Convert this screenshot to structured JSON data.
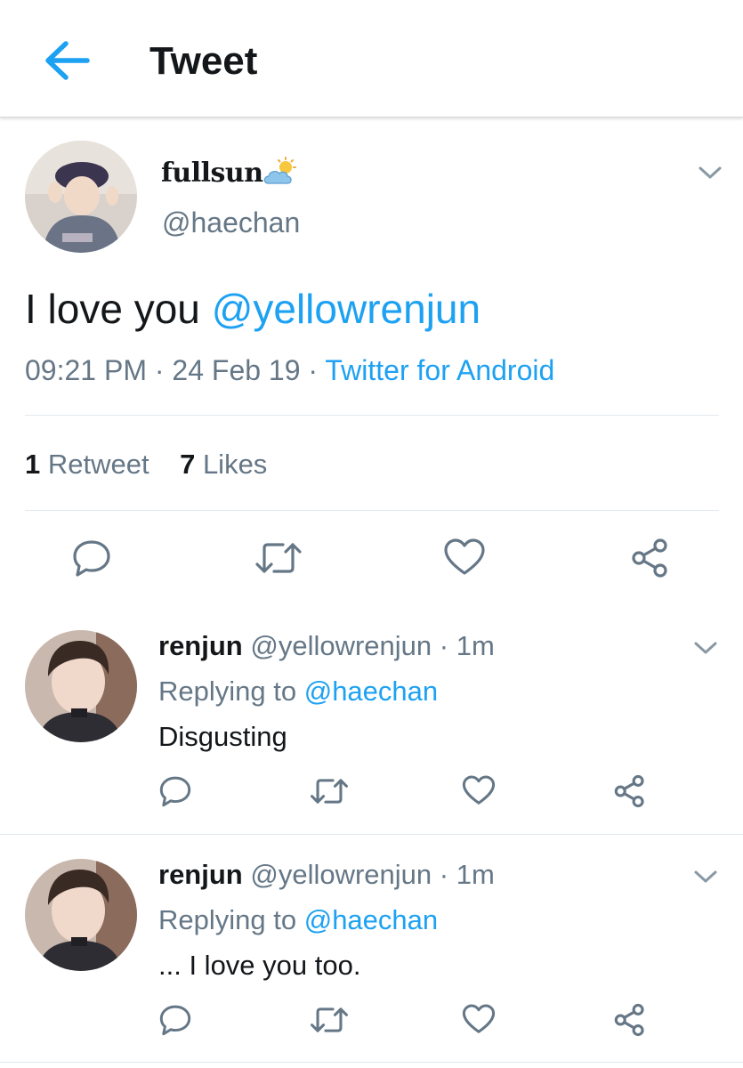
{
  "header": {
    "title": "Tweet",
    "back_icon": "arrow-left-icon",
    "accent": "#1da1f2"
  },
  "tweet": {
    "display_name": "fullsun",
    "name_emoji": "sun-behind-cloud-icon",
    "handle": "@haechan",
    "text": "I love you ",
    "mention": "@yellowrenjun",
    "time": "09:21 PM",
    "sep": " · ",
    "date": "24 Feb 19",
    "source": "Twitter for Android",
    "stats": {
      "retweets_count": "1",
      "retweets_label": "Retweet",
      "likes_count": "7",
      "likes_label": "Likes"
    },
    "actions": [
      "reply-icon",
      "retweet-icon",
      "heart-icon",
      "share-icon"
    ]
  },
  "replies": [
    {
      "name": "renjun",
      "handle": "@yellowrenjun",
      "time": "· 1m",
      "replying_prefix": "Replying to ",
      "replying_to": "@haechan",
      "text": "Disgusting"
    },
    {
      "name": "renjun",
      "handle": "@yellowrenjun",
      "time": "· 1m",
      "replying_prefix": "Replying to ",
      "replying_to": "@haechan",
      "text": "... I love you too."
    }
  ],
  "colors": {
    "text_primary": "#14171a",
    "text_secondary": "#657786",
    "link": "#1da1f2",
    "divider": "#e1e8ed"
  }
}
